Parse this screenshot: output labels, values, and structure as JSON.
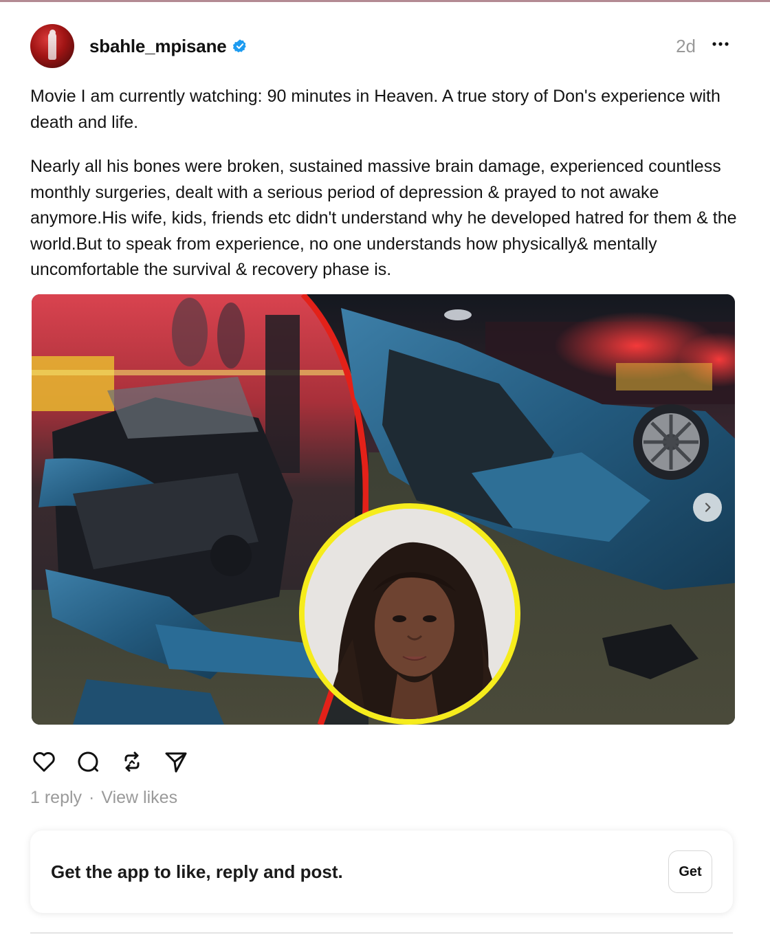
{
  "post": {
    "username": "sbahle_mpisane",
    "time": "2d",
    "paragraph_1": "Movie I am currently watching: 90 minutes in Heaven. A true story of Don's experience with death and life.",
    "paragraph_2": "Nearly all his bones were broken, sustained massive brain damage, experienced countless monthly surgeries, dealt with a serious period of depression & prayed to not awake anymore.His wife, kids, friends etc didn't understand why he developed hatred for them & the world.But to speak from experience, no one understands how physically& mentally uncomfortable the survival & recovery phase is.",
    "replies": "1 reply",
    "separator": "·",
    "view_likes": "View likes"
  },
  "banner": {
    "text": "Get the app to like, reply and post.",
    "button": "Get"
  },
  "icons": {
    "verified": "verified-badge-icon",
    "more": "more-dots-icon",
    "like": "heart-icon",
    "reply": "comment-bubble-icon",
    "repost": "repost-icon",
    "share": "send-icon",
    "next": "chevron-right-icon"
  },
  "colors": {
    "verified": "#1d9bf0",
    "portrait_ring": "#f6ec1c",
    "divider_line": "#e32119",
    "muted_text": "#999999"
  }
}
